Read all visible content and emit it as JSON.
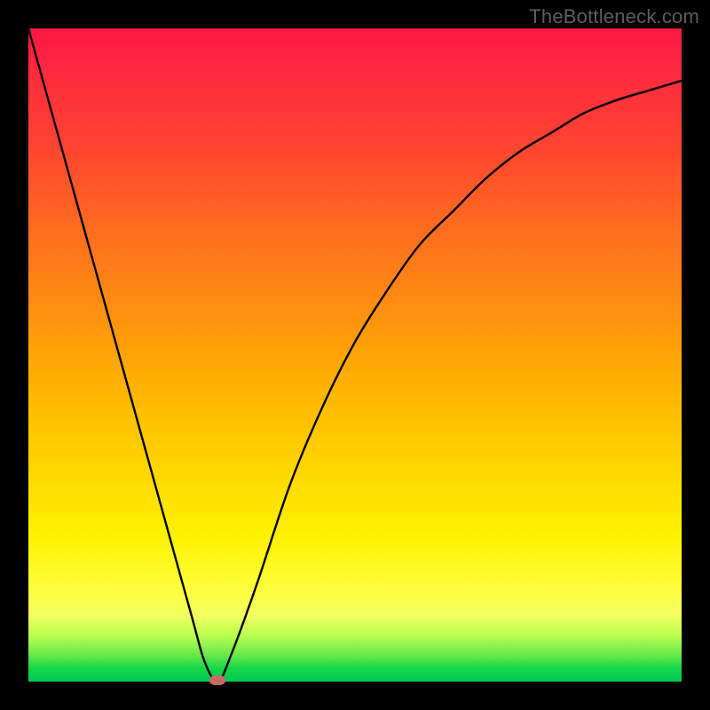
{
  "watermark": "TheBottleneck.com",
  "colors": {
    "gradient_top": "#ff1744",
    "gradient_mid1": "#ff8c12",
    "gradient_mid2": "#fff200",
    "gradient_bottom": "#00c853",
    "curve": "#000000",
    "marker": "#c96b60",
    "frame": "#000000"
  },
  "chart_data": {
    "type": "line",
    "title": "",
    "xlabel": "",
    "ylabel": "",
    "xlim": [
      0,
      100
    ],
    "ylim": [
      0,
      100
    ],
    "grid": false,
    "legend": false,
    "series": [
      {
        "name": "bottleneck-curve",
        "x": [
          0,
          5,
          10,
          15,
          20,
          25,
          27,
          29,
          31,
          35,
          40,
          45,
          50,
          55,
          60,
          65,
          70,
          75,
          80,
          85,
          90,
          95,
          100
        ],
        "values": [
          100,
          82,
          64,
          46,
          28,
          10,
          3,
          0,
          4,
          15,
          30,
          42,
          52,
          60,
          67,
          72,
          77,
          81,
          84,
          87,
          89,
          90.5,
          92
        ]
      }
    ],
    "annotations": [
      {
        "name": "minimum-marker",
        "x": 29,
        "y": 0
      }
    ]
  }
}
